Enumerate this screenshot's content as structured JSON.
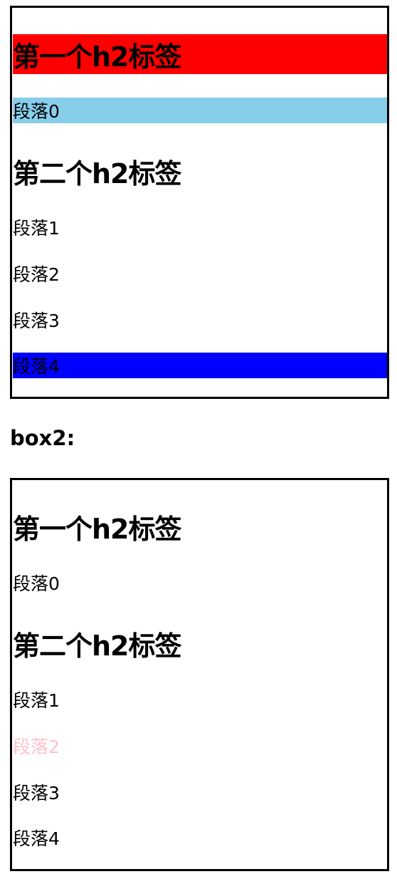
{
  "box1": {
    "heading1": {
      "text": "第一个h2标签",
      "bg": "#ff0000"
    },
    "p0": {
      "text": "段落0",
      "bg": "#87ceeb"
    },
    "heading2": {
      "text": "第二个h2标签"
    },
    "p1": {
      "text": "段落1"
    },
    "p2": {
      "text": "段落2"
    },
    "p3": {
      "text": "段落3"
    },
    "p4": {
      "text": "段落4",
      "bg": "#0000ff"
    }
  },
  "box2_label": "box2:",
  "box2": {
    "heading1": {
      "text": "第一个h2标签"
    },
    "p0": {
      "text": "段落0"
    },
    "heading2": {
      "text": "第二个h2标签"
    },
    "p1": {
      "text": "段落1"
    },
    "p2": {
      "text": "段落2",
      "color": "#ffc0cb"
    },
    "p3": {
      "text": "段落3"
    },
    "p4": {
      "text": "段落4"
    }
  }
}
